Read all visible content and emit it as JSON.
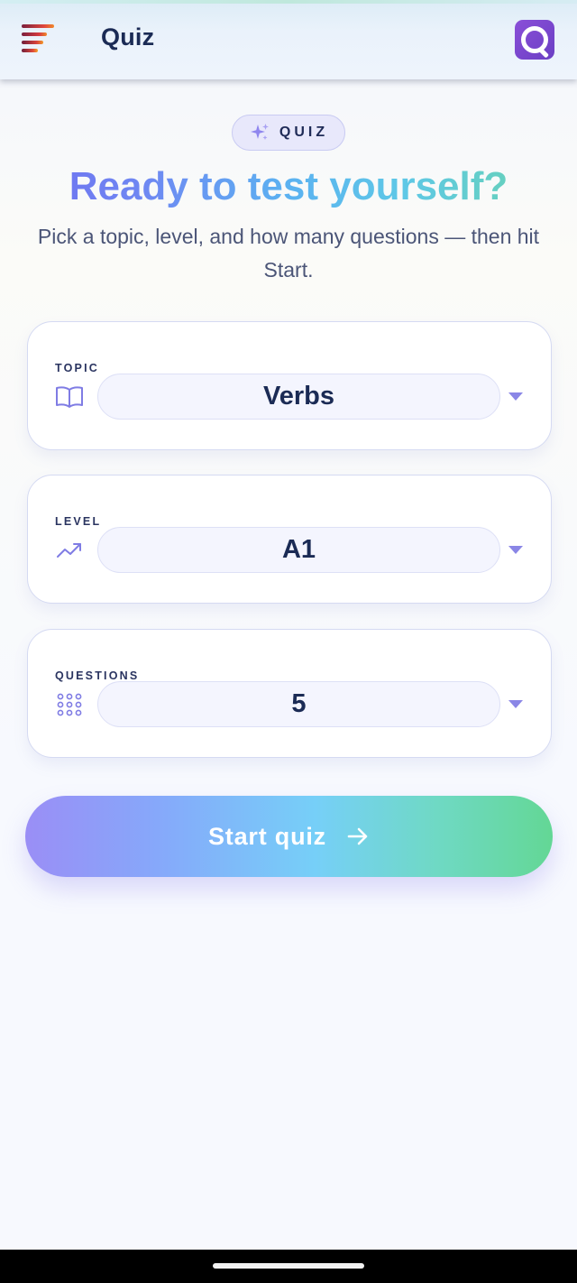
{
  "header": {
    "title": "Quiz",
    "menu_icon": "hamburger-menu-icon",
    "logo_icon": "quiz-q-logo-icon"
  },
  "hero": {
    "badge_label": "QUIZ",
    "badge_icon": "sparkles-icon",
    "title": "Ready to test yourself?",
    "subtitle": "Pick a topic, level, and how many questions — then hit Start."
  },
  "settings": {
    "topic": {
      "label": "TOPIC",
      "value": "Verbs",
      "icon": "book-open-icon"
    },
    "level": {
      "label": "LEVEL",
      "value": "A1",
      "icon": "trending-up-icon"
    },
    "questions": {
      "label": "QUESTIONS",
      "value": "5",
      "icon": "dots-grid-icon"
    }
  },
  "start_button": {
    "label": "Start quiz",
    "icon": "arrow-right-icon"
  },
  "colors": {
    "title_dark": "#1b2b55",
    "accent_purple": "#8a86e6",
    "gradient_start": "#9a8ef6",
    "gradient_end": "#63d795"
  }
}
